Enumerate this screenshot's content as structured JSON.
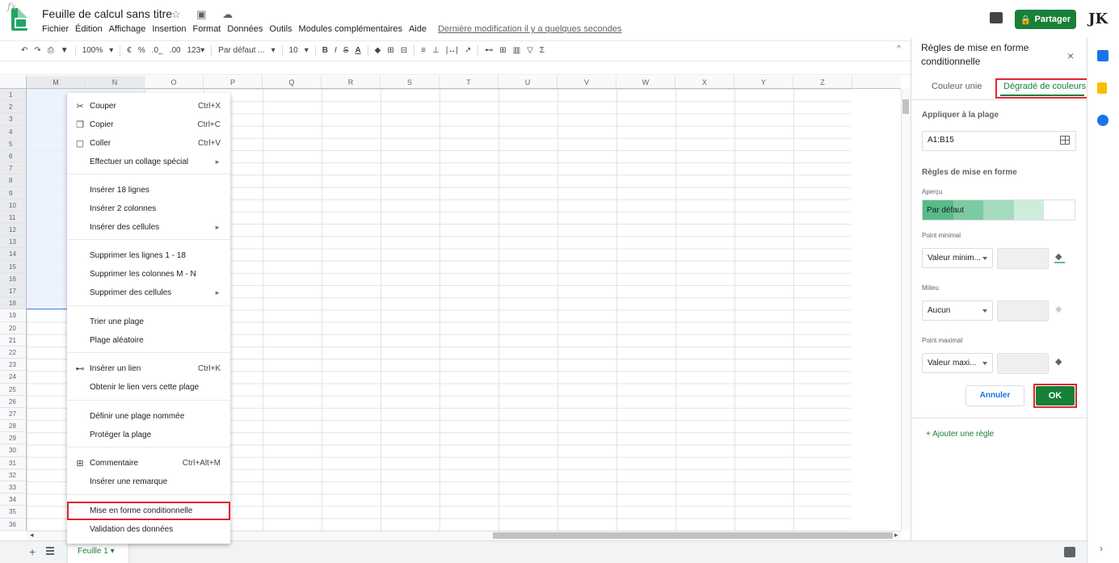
{
  "doc": {
    "title": "Feuille de calcul sans titre",
    "title_icons": "☆ ▣ ☁",
    "menu": [
      "Fichier",
      "Édition",
      "Affichage",
      "Insertion",
      "Format",
      "Données",
      "Outils",
      "Modules complémentaires",
      "Aide"
    ],
    "last_modified": "Dernière modification il y a quelques secondes",
    "share_label": "Partager",
    "avatar": "JK"
  },
  "toolbar": {
    "undo": "↶",
    "redo": "↷",
    "print": "⎙",
    "paint": "▼",
    "zoom": "100%",
    "currency": "€",
    "percent": "%",
    "dec_less": ".0_",
    "dec_more": ".00",
    "format_more": "123▾",
    "font": "Par défaut ...",
    "font_size": "10",
    "bold": "B",
    "italic": "I",
    "strike": "S",
    "text_color": "A",
    "fill": "◆",
    "borders": "⊞",
    "merge": "⊟",
    "halign": "≡",
    "valign": "⊥",
    "wrap": "|↔|",
    "rotate": "↗",
    "link": "⊷",
    "comment": "⊞",
    "chart": "▥",
    "filter": "▽",
    "functions": "Σ",
    "collapse": "^"
  },
  "formula": {
    "fx": "fx"
  },
  "grid": {
    "columns": [
      "M",
      "N",
      "O",
      "P",
      "Q",
      "R",
      "S",
      "T",
      "U",
      "V",
      "W",
      "X",
      "Y",
      "Z"
    ],
    "rows": [
      "1",
      "2",
      "3",
      "4",
      "5",
      "6",
      "7",
      "8",
      "9",
      "10",
      "11",
      "12",
      "13",
      "14",
      "15",
      "16",
      "17",
      "18",
      "19",
      "20",
      "21",
      "22",
      "23",
      "24",
      "25",
      "26",
      "27",
      "28",
      "29",
      "30",
      "31",
      "32",
      "33",
      "34",
      "35",
      "36"
    ]
  },
  "sheet_tab": "Feuille 1  ▾",
  "context_menu": {
    "items": [
      {
        "icon": "✂",
        "label": "Couper",
        "shortcut": "Ctrl+X"
      },
      {
        "icon": "❐",
        "label": "Copier",
        "shortcut": "Ctrl+C"
      },
      {
        "icon": "▢",
        "label": "Coller",
        "shortcut": "Ctrl+V"
      },
      {
        "icon": "",
        "label": "Effectuer un collage spécial",
        "submenu": "►"
      },
      {
        "icon": "",
        "label": "Insérer 18 lignes"
      },
      {
        "icon": "",
        "label": "Insérer 2 colonnes"
      },
      {
        "icon": "",
        "label": "Insérer des cellules",
        "submenu": "►"
      },
      {
        "icon": "",
        "label": "Supprimer les lignes 1 - 18"
      },
      {
        "icon": "",
        "label": "Supprimer les colonnes M - N"
      },
      {
        "icon": "",
        "label": "Supprimer des cellules",
        "submenu": "►"
      },
      {
        "icon": "",
        "label": "Trier une plage"
      },
      {
        "icon": "",
        "label": "Plage aléatoire"
      },
      {
        "icon": "⊷",
        "label": "Insérer un lien",
        "shortcut": "Ctrl+K"
      },
      {
        "icon": "",
        "label": "Obtenir le lien vers cette plage"
      },
      {
        "icon": "",
        "label": "Définir une plage nommée"
      },
      {
        "icon": "",
        "label": "Protéger la plage"
      },
      {
        "icon": "⊞",
        "label": "Commentaire",
        "shortcut": "Ctrl+Alt+M"
      },
      {
        "icon": "",
        "label": "Insérer une remarque"
      },
      {
        "icon": "",
        "label": "Mise en forme conditionnelle"
      },
      {
        "icon": "",
        "label": "Validation des données"
      }
    ]
  },
  "panel": {
    "title": "Règles de mise en forme conditionnelle",
    "close": "×",
    "tab_solid": "Couleur unie",
    "tab_gradient": "Dégradé de couleurs",
    "apply_label": "Appliquer à la plage",
    "range": "A1:B15",
    "rules_label": "Règles de mise en forme",
    "preview_label": "Aperçu",
    "preview_text": "Par défaut",
    "preview_colors": [
      "#57bb8a",
      "#7ccaa2",
      "#a4dbbf",
      "#cdeddc",
      "#ffffff"
    ],
    "min_label": "Point minimal",
    "min_select": "Valeur minim...",
    "mid_label": "Milieu",
    "mid_select": "Aucun",
    "max_label": "Point maximal",
    "max_select": "Valeur maxi...",
    "fill_icon": "◆",
    "min_color": "#57bb8a",
    "cancel": "Annuler",
    "ok": "OK",
    "add_rule": "+   Ajouter une règle"
  },
  "colors": {
    "accent": "#188038",
    "highlight": "#e0272d",
    "selection": "#e8f0fe"
  }
}
